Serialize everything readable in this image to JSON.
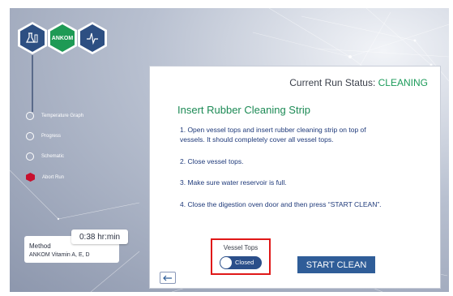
{
  "header": {
    "icons": [
      {
        "name": "beaker-vial-icon",
        "color": "#2d4f82"
      },
      {
        "name": "ankom-logo-icon",
        "text": "ANKOM",
        "color": "#1e9a55"
      },
      {
        "name": "pulse-waveform-icon",
        "color": "#2d4f82"
      }
    ]
  },
  "sidebar": {
    "items": [
      {
        "label": "Temperature Graph",
        "icon": "circle-icon"
      },
      {
        "label": "Progress",
        "icon": "circle-icon"
      },
      {
        "label": "Schematic",
        "icon": "circle-icon"
      },
      {
        "label": "Abort Run",
        "icon": "red-hexagon-icon",
        "color": "#c8102e"
      }
    ]
  },
  "method": {
    "label": "Method",
    "value": "ANKOM Vitamin A, E, D",
    "time": "0:38 hr:min"
  },
  "panel": {
    "status_label": "Current Run Status:",
    "status_value": "CLEANING",
    "status_color": "#1c9b5a",
    "title": "Insert Rubber Cleaning Strip",
    "steps": [
      "1. Open vessel tops and insert rubber cleaning strip on top of",
      "vessels. It should completely cover all vessel tops.",
      "2. Close vessel tops.",
      "3. Make sure water reservoir is full.",
      "4. Close the digestion oven door and then press “START CLEAN”."
    ],
    "vessel_tops_label": "Vessel Tops",
    "toggle_state": "Closed",
    "start_button": "START CLEAN",
    "back_icon": "left-arrow-icon",
    "highlight_color": "#e01818"
  }
}
